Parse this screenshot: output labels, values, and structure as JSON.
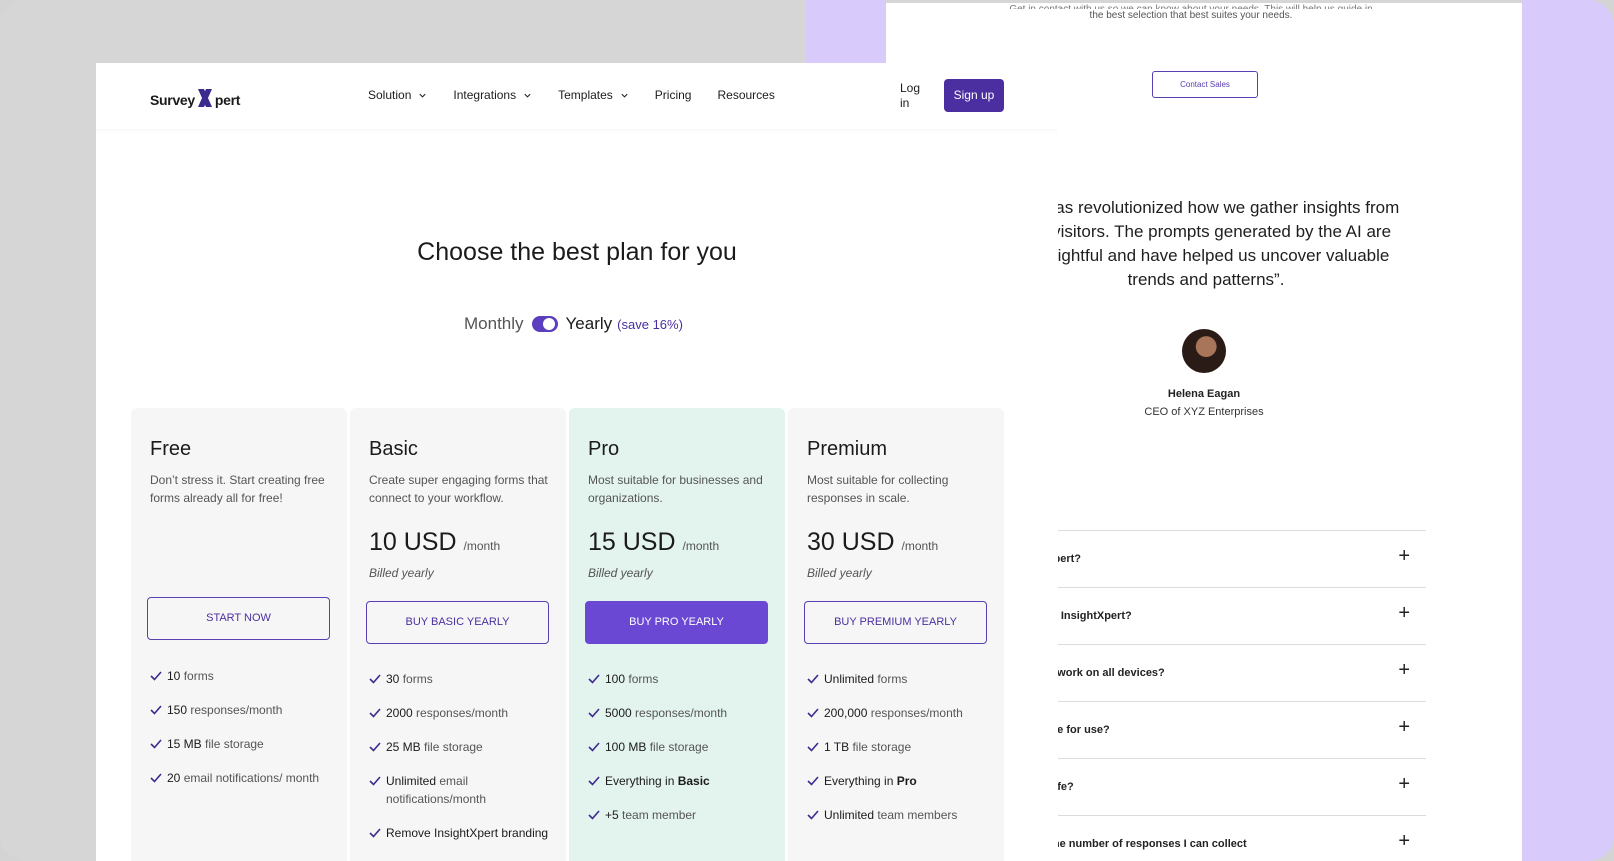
{
  "back_page": {
    "top_text_line1": "Get in contact with us so we can know about your needs. This will help us guide in making",
    "top_text_line2": "the best selection that best suites your needs.",
    "contact_sales_label": "Contact Sales",
    "quote": "erts has revolutionized how we gather insights from site visitors. The prompts generated by the AI are y insightful and have helped us uncover valuable trends and patterns”.",
    "quote_lines": [
      "erts has revolutionized how we gather insights from",
      "site visitors. The prompts generated by the AI are",
      "y insightful and have helped us uncover valuable",
      "trends and patterns”."
    ],
    "person_name": "Helena Eagan",
    "person_role": "CEO of XYZ Enterprises",
    "faq": [
      "ightXpert?",
      "o with InsightXpert?",
      "Xpert work on all devices?",
      "ert free for use?",
      "ata safe?",
      "it to the number of responses I can collect"
    ],
    "faq_plus": "+"
  },
  "nav": {
    "logo_left": "Survey",
    "logo_x": "X",
    "logo_right": "pert",
    "menu": [
      "Solution",
      "Integrations",
      "Templates",
      "Pricing",
      "Resources"
    ],
    "login_label": "Log in",
    "signup_label": "Sign up"
  },
  "pricing": {
    "heading": "Choose the best plan for you",
    "toggle": {
      "monthly": "Monthly",
      "yearly": "Yearly",
      "save": "(save 16%)",
      "selected": "Yearly"
    },
    "plans": [
      {
        "name": "Free",
        "desc": "Don’t stress it. Start creating free forms already all for free!",
        "button": "START NOW",
        "features": [
          {
            "strong": "10",
            "text": " forms"
          },
          {
            "strong": "150",
            "text": " responses/month"
          },
          {
            "strong": "15 MB",
            "text": " file storage"
          },
          {
            "strong": "20",
            "text": " email notifications/ month"
          }
        ]
      },
      {
        "name": "Basic",
        "desc": "Create super engaging forms that connect to your workflow.",
        "price": "10 USD",
        "per": "/month",
        "billed": "Billed yearly",
        "button": "BUY BASIC YEARLY",
        "features": [
          {
            "strong": "30",
            "text": " forms"
          },
          {
            "strong": "2000",
            "text": " responses/month"
          },
          {
            "strong": "25 MB",
            "text": " file storage"
          },
          {
            "strong": "Unlimited",
            "text": " email notifications/month"
          },
          {
            "strong": "Remove InsightXpert branding",
            "text": ""
          }
        ]
      },
      {
        "name": "Pro",
        "desc": "Most suitable for businesses and organizations.",
        "price": "15 USD",
        "per": "/month",
        "billed": "Billed yearly",
        "button": "BUY PRO YEARLY",
        "features": [
          {
            "strong": "100",
            "text": " forms"
          },
          {
            "strong": "5000",
            "text": " responses/month"
          },
          {
            "strong": "100 MB",
            "text": " file storage"
          },
          {
            "strong": "Everything in ",
            "bold": "Basic",
            "text": ""
          },
          {
            "strong": "+5",
            "text": " team member"
          }
        ]
      },
      {
        "name": "Premium",
        "desc": " Most suitable for collecting responses in scale.",
        "price": "30 USD",
        "per": "/month",
        "billed": "Billed yearly",
        "button": "BUY PREMIUM YEARLY",
        "features": [
          {
            "strong": "Unlimited",
            "text": " forms"
          },
          {
            "strong": "200,000",
            "text": " responses/month"
          },
          {
            "strong": "1 TB",
            "text": " file storage"
          },
          {
            "strong": "Everything in ",
            "bold": "Pro",
            "text": ""
          },
          {
            "strong": "Unlimited",
            "text": " team members"
          }
        ]
      }
    ]
  },
  "colors": {
    "brand_purple": "#4b2fa0",
    "button_purple": "#6a48d4",
    "lavender": "#d8cbfb",
    "pro_card_bg": "#e3f3ee"
  }
}
